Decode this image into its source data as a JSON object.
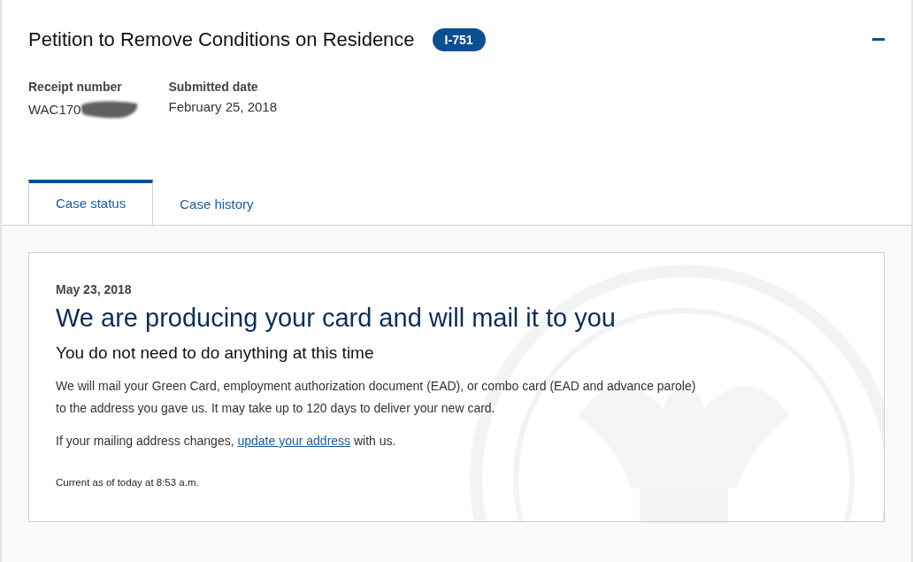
{
  "case": {
    "title": "Petition to Remove Conditions on Residence",
    "form_badge": "I-751",
    "expanded": true,
    "fields": [
      {
        "label": "Receipt number",
        "value": "WAC170",
        "redacted": true
      },
      {
        "label": "Submitted date",
        "value": "February 25, 2018",
        "redacted": false
      }
    ]
  },
  "tabs": [
    {
      "label": "Case status",
      "selected": true
    },
    {
      "label": "Case history",
      "selected": false
    }
  ],
  "status": {
    "date": "May 23, 2018",
    "heading": "We are producing your card and will mail it to you",
    "subheading": "You do not need to do anything at this time",
    "body": "We will mail your Green Card, employment authorization document (EAD), or combo card (EAD and advance parole) to the address you gave us. It may take up to 120 days to deliver your new card.",
    "address_before": "If your mailing address changes,",
    "address_link": "update your address",
    "address_after": "with us.",
    "updated": "Current as of today at 8:53 a.m."
  }
}
